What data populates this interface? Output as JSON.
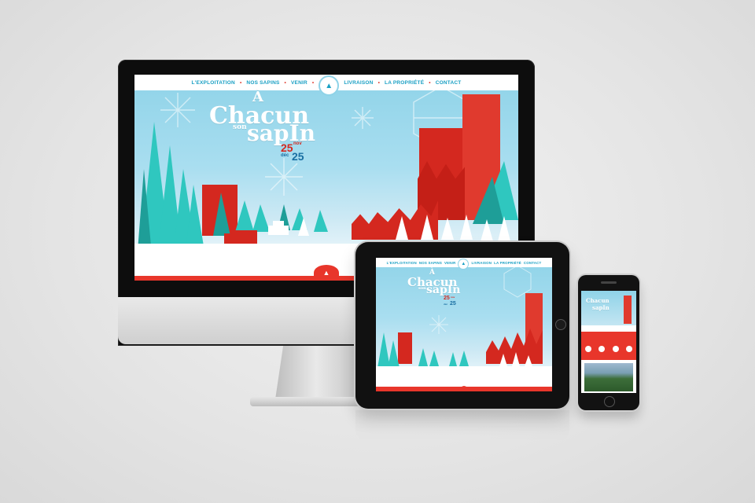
{
  "site": {
    "nav_items": [
      "L'EXPLOITATION",
      "NOS SAPINS",
      "VENIR",
      "LIVRAISON",
      "LA PROPRIÉTÉ",
      "CONTACT"
    ],
    "title_a": "À",
    "title_line1": "Chacun",
    "title_son": "son",
    "title_line2": "sapIn",
    "date_start_day": "25",
    "date_start_month": "nov",
    "date_end_month": "déc",
    "date_end_day": "25"
  },
  "colors": {
    "sky": "#a9def0",
    "nav_text": "#1aa0c4",
    "accent_red": "#e8362b",
    "tree_teal": "#2fc7bf",
    "building_red": "#d4281f"
  },
  "icons": {
    "badge": "tree-icon",
    "footer": "tree-icon"
  }
}
